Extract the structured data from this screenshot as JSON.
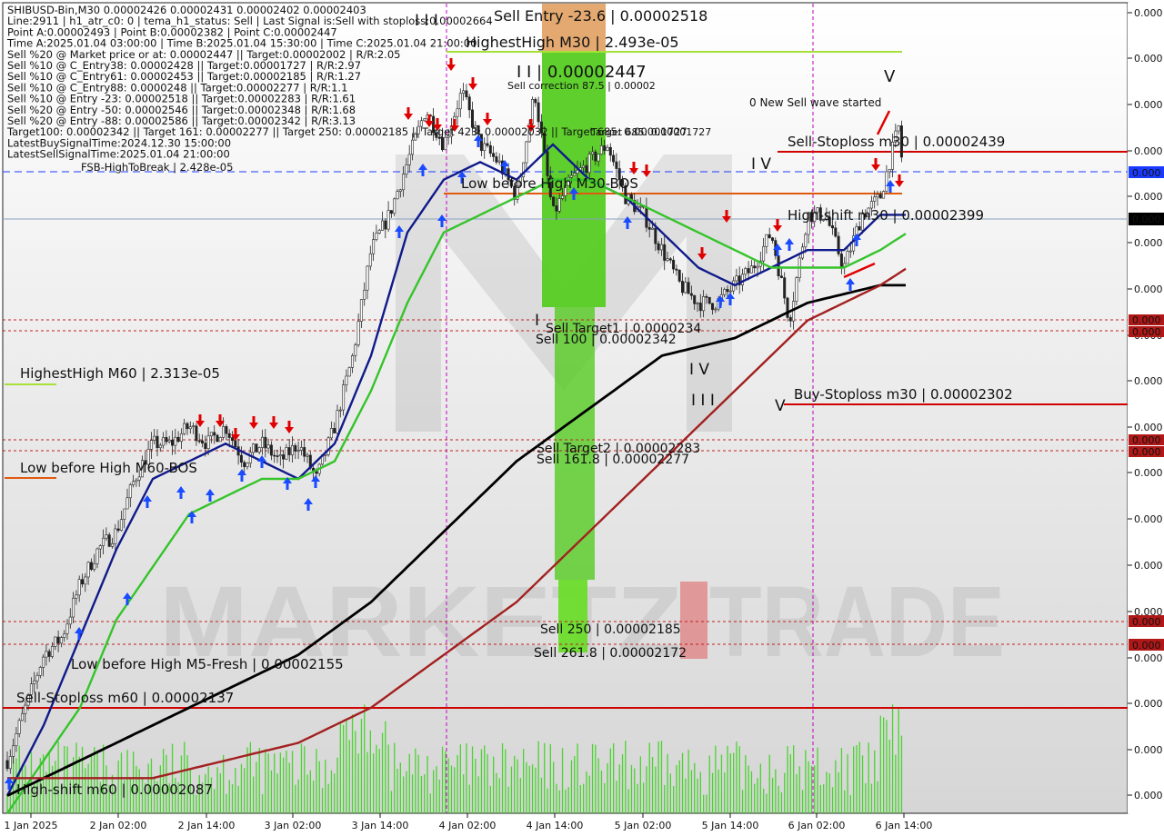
{
  "colors": {
    "background": "#ffffff",
    "plot_bg_top": "#ffffff",
    "plot_bg_bottom": "#d6d6d6",
    "ema_fast": "#101a8a",
    "ema_mid": "#35c42a",
    "ema_slow": "#000000",
    "ema_long": "#a32020",
    "level_red": "#d00000",
    "level_orange": "#e05a10",
    "level_green": "#a8e03a",
    "sell_zone_top": "#e0a060",
    "sell_zone": "#55cc22",
    "volume": "#3bd11e",
    "arrow_up": "#1a4bff",
    "arrow_down": "#e00000",
    "label_red": "#a01010",
    "label_gray": "#555555",
    "label_green": "#2a8a2a",
    "current_price_tag": "#000000",
    "blue_price_tag": "#1a3bff"
  },
  "info_panel": [
    "SHIBUSD-Bin,M30  0.00002426 0.00002431 0.00002402 0.00002403",
    "Line:2911 | h1_atr_c0: 0 | tema_h1_status: Sell | Last Signal is:Sell with stoploss:0.00002664",
    "Point A:0.00002493 | Point B:0.00002382 | Point C:0.00002447",
    "Time A:2025.01.04 03:00:00 | Time B:2025.01.04 15:30:00 | Time C:2025.01.04 21:00:00",
    "Sell %20 @ Market price or at: 0.00002447 || Target:0.00002002 | R/R:2.05",
    "Sell %10 @ C_Entry38: 0.00002428 || Target:0.00001727 | R/R:2.97",
    "Sell %10 @ C_Entry61: 0.00002453 || Target:0.00002185 | R/R:1.27",
    "Sell %10 @ C_Entry88: 0.0000248 || Target:0.00002277 | R/R:1.1",
    "Sell %10 @ Entry -23: 0.00002518 || Target:0.00002283 | R/R:1.61",
    "Sell %20 @ Entry -50: 0.00002546 || Target:0.00002348 | R/R:1.68",
    "Sell %20 @ Entry -88: 0.00002586 || Target:0.00002342 | R/R:3.13",
    "Target100: 0.00002342 || Target 161: 0.00002277 || Target 250: 0.00002185 || Target 423: 0.00002032 || Target 685: 0.00001727",
    "LatestBuySignalTime:2024.12.30 15:00:00",
    "LatestSellSignalTime:2025.01.04 21:00:00"
  ],
  "fsb_label": "FSB-HighToBreak | 2.428e-05",
  "annotations": {
    "sell_entry": "Sell Entry -23.6 | 0.00002518",
    "highest_high_m30": "HighestHigh   M30 | 2.493e-05",
    "point_c": "I I | 0.00002447",
    "sell_correction": "Sell correction 87.5 | 0.00002",
    "new_sell_wave": "0 New Sell wave started",
    "sell_stoploss_m30": "Sell-Stoploss m30 | 0.00002439",
    "low_before_high_m30": "Low before High   M30-BOS",
    "high_shift_m30": "High-shift m30 | 0.00002399",
    "sell_target1": "Sell Target1 | 0.0000234",
    "sell_100": "Sell 100 | 0.00002342",
    "buy_stoploss_m30": "Buy-Stoploss m30 | 0.00002302",
    "sell_target2": "Sell Target2 | 0.00002283",
    "sell_161": "Sell 161.8 | 0.00002277",
    "sell_250": "Sell  250 | 0.00002185",
    "sell_261": "Sell  261.8 | 0.00002172",
    "highest_high_m60": "HighestHigh   M60 | 2.313e-05",
    "low_before_high_m60": "Low before High   M60-BOS",
    "low_before_high_m5": "Low before High   M5-Fresh | 0.00002155",
    "sell_stoploss_m60": "Sell-Stoploss m60 | 0.00002137",
    "high_shift_m60": "High-shift m60 | 0.00002087",
    "sell_target_overlay": "Target 685: 0.00001727"
  },
  "wave_labels": [
    "I I I",
    "I I I",
    "I V",
    "I V",
    "I I I",
    "V",
    "V",
    "I"
  ],
  "watermark": {
    "left": "MARKETZ",
    "right": "TRADE"
  },
  "price_axis_labels": [
    "0.000",
    "0.000",
    "0.000",
    "0.000",
    "0.000",
    "0.000",
    "0.000",
    "0.000",
    "0.000",
    "0.000",
    "0.000",
    "0.000",
    "0.000",
    "0.000",
    "0.000",
    "0.000",
    "0.000",
    "0.000"
  ],
  "price_tags": {
    "blue": "0.000",
    "current": "0.000",
    "red1": "0.000",
    "red2": "0.000",
    "red3": "0.000",
    "red4": "0.000",
    "red5": "0.000",
    "red6": "0.000"
  },
  "chart_data": {
    "type": "line",
    "symbol": "SHIBUSD-Bin",
    "timeframe": "M30",
    "title": "SHIBUSD-Bin,M30",
    "x_tick_labels": [
      "1 Jan 2025",
      "2 Jan 02:00",
      "2 Jan 14:00",
      "3 Jan 02:00",
      "3 Jan 14:00",
      "4 Jan 02:00",
      "4 Jan 14:00",
      "5 Jan 02:00",
      "5 Jan 14:00",
      "6 Jan 02:00",
      "6 Jan 14:00"
    ],
    "ylim": [
      2.06e-05,
      2.52e-05
    ],
    "series": [
      {
        "kind": "price",
        "x": [
          0,
          20,
          40,
          60,
          80,
          100,
          120,
          140,
          160,
          180,
          200,
          220,
          240,
          260,
          280,
          300,
          320,
          340,
          360,
          380,
          400,
          420,
          440,
          460,
          480,
          500,
          520,
          540,
          560,
          580,
          600,
          620,
          640,
          660,
          680,
          700,
          720,
          740,
          760,
          780,
          800,
          820,
          840,
          860,
          880,
          900,
          920,
          940,
          960,
          980,
          990
        ],
        "values": [
          2.09e-05,
          2.12e-05,
          2.15e-05,
          2.16e-05,
          2.19e-05,
          2.21e-05,
          2.22e-05,
          2.25e-05,
          2.27e-05,
          2.27e-05,
          2.28e-05,
          2.27e-05,
          2.28e-05,
          2.26e-05,
          2.27e-05,
          2.26e-05,
          2.27e-05,
          2.25e-05,
          2.28e-05,
          2.32e-05,
          2.38e-05,
          2.4e-05,
          2.43e-05,
          2.46e-05,
          2.44e-05,
          2.47e-05,
          2.44e-05,
          2.43e-05,
          2.41e-05,
          2.47e-05,
          2.4e-05,
          2.42e-05,
          2.43e-05,
          2.44e-05,
          2.41e-05,
          2.4e-05,
          2.38e-05,
          2.36e-05,
          2.35e-05,
          2.35e-05,
          2.36e-05,
          2.37e-05,
          2.39e-05,
          2.34e-05,
          2.4e-05,
          2.4e-05,
          2.37e-05,
          2.4e-05,
          2.41e-05,
          2.45e-05,
          2.4e-05
        ]
      },
      {
        "kind": "ema_fast",
        "x": [
          0,
          40,
          80,
          120,
          160,
          200,
          240,
          280,
          320,
          360,
          400,
          440,
          480,
          520,
          560,
          600,
          640,
          680,
          720,
          760,
          800,
          840,
          880,
          920,
          960,
          990
        ],
        "values": [
          2.07e-05,
          2.11e-05,
          2.16e-05,
          2.21e-05,
          2.25e-05,
          2.26e-05,
          2.27e-05,
          2.26e-05,
          2.25e-05,
          2.27e-05,
          2.32e-05,
          2.39e-05,
          2.42e-05,
          2.43e-05,
          2.42e-05,
          2.44e-05,
          2.42e-05,
          2.41e-05,
          2.39e-05,
          2.37e-05,
          2.36e-05,
          2.37e-05,
          2.38e-05,
          2.38e-05,
          2.4e-05,
          2.4e-05
        ]
      },
      {
        "kind": "ema_mid",
        "x": [
          0,
          40,
          80,
          120,
          160,
          200,
          240,
          280,
          320,
          360,
          400,
          440,
          480,
          520,
          560,
          600,
          640,
          680,
          720,
          760,
          800,
          840,
          880,
          920,
          960,
          990
        ],
        "values": [
          2.06e-05,
          2.09e-05,
          2.12e-05,
          2.17e-05,
          2.2e-05,
          2.23e-05,
          2.24e-05,
          2.25e-05,
          2.25e-05,
          2.26e-05,
          2.3e-05,
          2.35e-05,
          2.39e-05,
          2.4e-05,
          2.41e-05,
          2.42e-05,
          2.42e-05,
          2.41e-05,
          2.4e-05,
          2.39e-05,
          2.38e-05,
          2.37e-05,
          2.37e-05,
          2.37e-05,
          2.38e-05,
          2.39e-05
        ]
      },
      {
        "kind": "ema_slow",
        "x": [
          0,
          80,
          160,
          240,
          320,
          400,
          480,
          560,
          640,
          720,
          800,
          880,
          960,
          990
        ],
        "values": [
          2.07e-05,
          2.09e-05,
          2.11e-05,
          2.13e-05,
          2.15e-05,
          2.18e-05,
          2.22e-05,
          2.26e-05,
          2.29e-05,
          2.32e-05,
          2.33e-05,
          2.35e-05,
          2.36e-05,
          2.36e-05
        ]
      },
      {
        "kind": "ema_long",
        "x": [
          0,
          80,
          160,
          240,
          320,
          400,
          480,
          560,
          640,
          720,
          800,
          880,
          960,
          990
        ],
        "values": [
          2.08e-05,
          2.08e-05,
          2.08e-05,
          2.09e-05,
          2.1e-05,
          2.12e-05,
          2.15e-05,
          2.18e-05,
          2.22e-05,
          2.26e-05,
          2.3e-05,
          2.34e-05,
          2.36e-05,
          2.37e-05
        ]
      }
    ],
    "levels": [
      {
        "name": "Sell Entry -23.6",
        "value": 2.518e-05
      },
      {
        "name": "HighestHigh M30",
        "value": 2.493e-05
      },
      {
        "name": "Sell-Stoploss m30",
        "value": 2.439e-05
      },
      {
        "name": "FSB-HighToBreak",
        "value": 2.428e-05
      },
      {
        "name": "Low before High M30-BOS",
        "value": 2.42e-05
      },
      {
        "name": "High-shift m30",
        "value": 2.399e-05
      },
      {
        "name": "Sell Target1",
        "value": 2.34e-05
      },
      {
        "name": "Sell 100",
        "value": 2.342e-05
      },
      {
        "name": "Buy-Stoploss m30",
        "value": 2.302e-05
      },
      {
        "name": "Sell Target2",
        "value": 2.283e-05
      },
      {
        "name": "Sell 161.8",
        "value": 2.277e-05
      },
      {
        "name": "Sell 250",
        "value": 2.185e-05
      },
      {
        "name": "Sell 261.8",
        "value": 2.172e-05
      },
      {
        "name": "HighestHigh M60",
        "value": 2.313e-05
      },
      {
        "name": "Low before High M5-Fresh",
        "value": 2.155e-05
      },
      {
        "name": "Sell-Stoploss m60",
        "value": 2.137e-05
      },
      {
        "name": "High-shift m60",
        "value": 2.087e-05
      }
    ],
    "grid": false,
    "legend": "none"
  }
}
